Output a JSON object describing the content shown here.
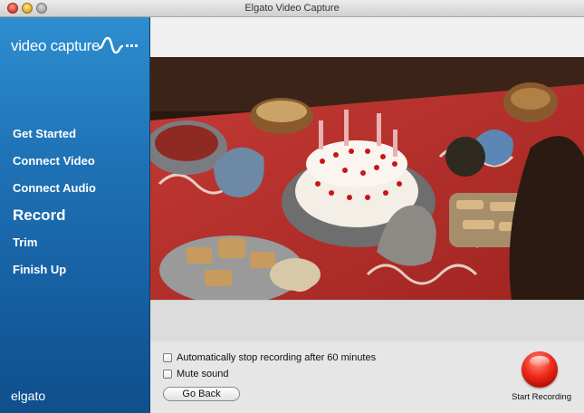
{
  "window": {
    "title": "Elgato Video Capture"
  },
  "sidebar": {
    "logo_text": "video capture",
    "items": [
      {
        "label": "Get Started",
        "active": false
      },
      {
        "label": "Connect Video",
        "active": false
      },
      {
        "label": "Connect Audio",
        "active": false
      },
      {
        "label": "Record",
        "active": true
      },
      {
        "label": "Trim",
        "active": false
      },
      {
        "label": "Finish Up",
        "active": false
      }
    ],
    "brand": "elgato"
  },
  "controls": {
    "auto_stop_label": "Automatically stop recording after 60 minutes",
    "auto_stop_checked": false,
    "mute_label": "Mute sound",
    "mute_checked": false,
    "go_back_label": "Go Back",
    "start_recording_label": "Start Recording"
  },
  "colors": {
    "sidebar_blue": "#1f73b6",
    "record_red": "#f02a1a"
  }
}
